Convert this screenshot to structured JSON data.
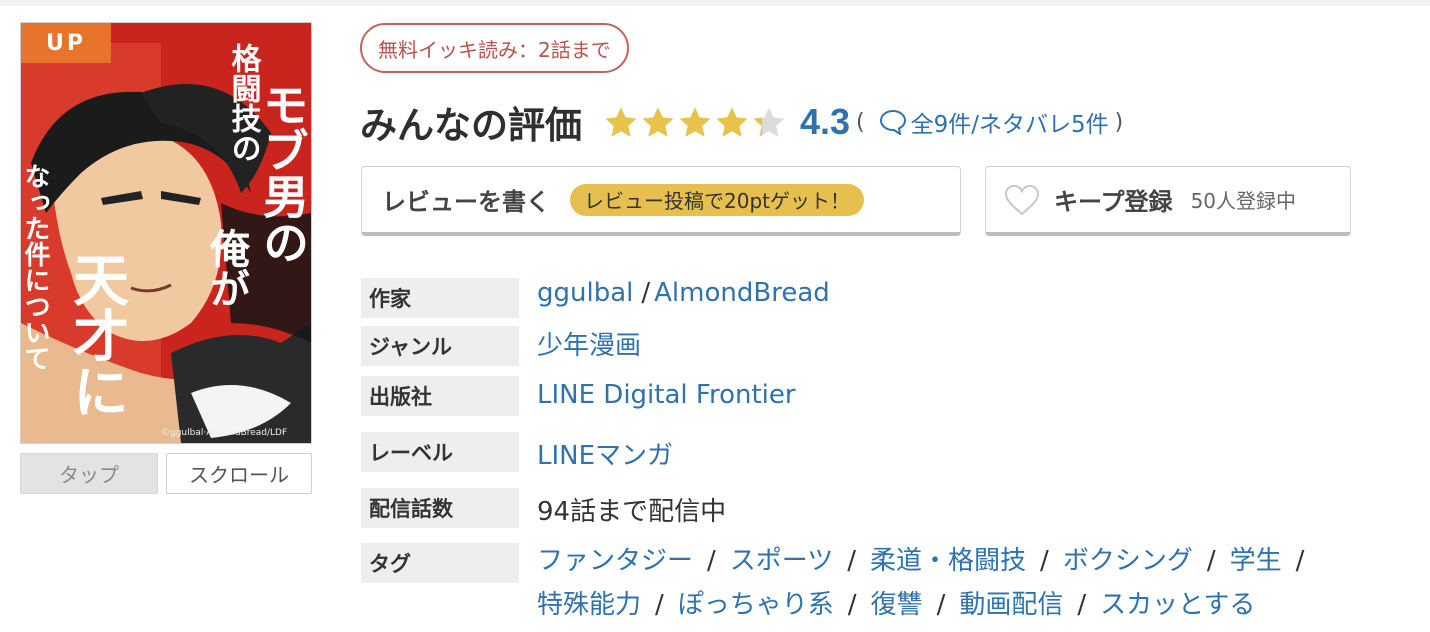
{
  "cover": {
    "badge": "UP",
    "title_lines": [
      "モブ男の",
      "俺が",
      "格闘技の",
      "天才に",
      "なった件について"
    ],
    "copyright": "©ggulbal·AlmondBread/LDF",
    "bg_color": "#c9241d"
  },
  "view_modes": {
    "tap": "タップ",
    "scroll": "スクロール"
  },
  "free_read": "無料イッキ読み：2話まで",
  "rating": {
    "title": "みんなの評価",
    "score": "4.3",
    "score_value": 4.3,
    "max_stars": 5,
    "star_color": "#e8c24a",
    "paren_open": "(",
    "paren_close": ")",
    "reviews_text": "全9件/ネタバレ5件",
    "bubble_icon": "speech-bubble-icon"
  },
  "review_button": {
    "label": "レビューを書く",
    "promo": "レビュー投稿で20ptゲット！"
  },
  "keep_button": {
    "label": "キープ登録",
    "count": "50人登録中",
    "icon": "heart-icon"
  },
  "info": {
    "author": {
      "label": "作家",
      "values": [
        "ggulbal",
        "AlmondBread"
      ],
      "separator": "/"
    },
    "genre": {
      "label": "ジャンル",
      "value": "少年漫画"
    },
    "publisher": {
      "label": "出版社",
      "value": "LINE Digital Frontier"
    },
    "label_row": {
      "label": "レーベル",
      "value": "LINEマンガ"
    },
    "episodes": {
      "label": "配信話数",
      "value": "94話まで配信中"
    },
    "tags": {
      "label": "タグ",
      "separator": "/",
      "items": [
        "ファンタジー",
        "スポーツ",
        "柔道・格闘技",
        "ボクシング",
        "学生",
        "特殊能力",
        "ぽっちゃり系",
        "復讐",
        "動画配信",
        "スカッとする"
      ]
    }
  },
  "colors": {
    "link": "#2f72ad",
    "accent_orange": "#e8742c",
    "pill_border": "#c2645e",
    "promo_yellow": "#e7bf4e"
  }
}
